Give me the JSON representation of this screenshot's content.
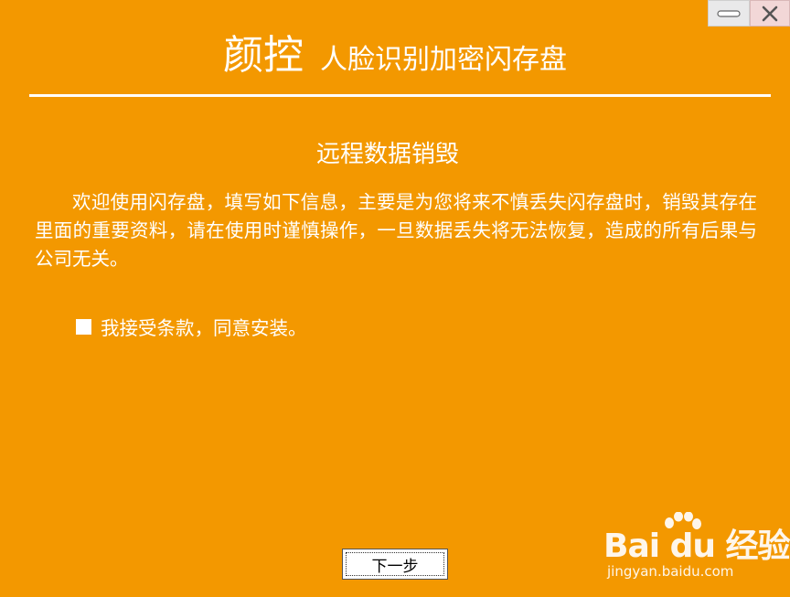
{
  "window": {
    "minimize_icon": "minimize-icon",
    "close_icon": "close-icon",
    "control_bg": "#e9e9ea",
    "close_bg": "#f2d7d7"
  },
  "header": {
    "brand": "颜控",
    "subtitle": "人脸识别加密闪存盘"
  },
  "section": {
    "title": "远程数据销毁",
    "body": "欢迎使用闪存盘，填写如下信息，主要是为您将来不慎丢失闪存盘时，销毁其存在里面的重要资料，请在使用时谨慎操作，一旦数据丢失将无法恢复，造成的所有后果与公司无关。"
  },
  "agreement": {
    "label": "我接受条款，同意安装。"
  },
  "footer": {
    "next_label": "下一步"
  },
  "watermark": {
    "logo": "Bai du 经验",
    "url": "jingyan.baidu.com"
  },
  "colors": {
    "background": "#f39800",
    "text": "#ffffff"
  }
}
